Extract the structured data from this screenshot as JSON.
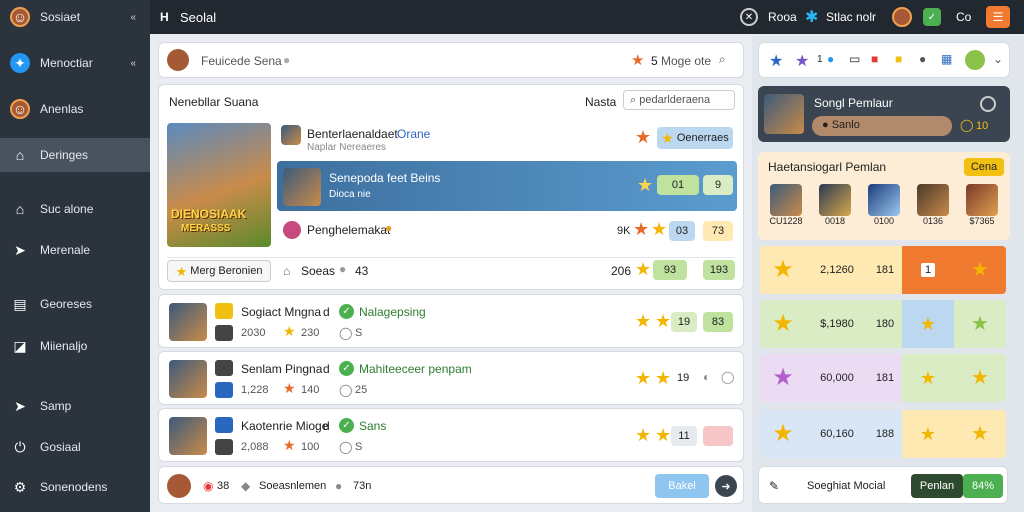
{
  "sidebar": {
    "items": [
      {
        "label": "Sosiaet",
        "icon": "avatar-icon",
        "chev": "«"
      },
      {
        "label": "Menoctiar",
        "icon": "twitter-icon",
        "chev": "«"
      },
      {
        "label": "Anenlas",
        "icon": "avatar-icon"
      },
      {
        "label": "Deringes",
        "icon": "home-icon",
        "active": true
      },
      {
        "label": "Suc alone",
        "icon": "home-icon"
      },
      {
        "label": "Merenale",
        "icon": "send-icon"
      },
      {
        "label": "Georeses",
        "icon": "list-icon"
      },
      {
        "label": "Miienaljo",
        "icon": "chart-icon"
      },
      {
        "label": "Samp",
        "icon": "send-icon"
      },
      {
        "label": "Gosiaal",
        "icon": "power-icon"
      },
      {
        "label": "Sonenodens",
        "icon": "gear-icon"
      }
    ]
  },
  "topbar": {
    "h": "H",
    "title": "Seolal",
    "user": "Rooa",
    "stats": "Stlac nolr",
    "time": "Co"
  },
  "search": {
    "placeholder": "Feuicede Sena",
    "count": "5",
    "hint": "Moge ote"
  },
  "panel": {
    "title": "Nenebllar Suana",
    "tab": "Nasta",
    "search": "pedarlderaena"
  },
  "featured": {
    "title_text": "DIENOSIAAK",
    "sub_text": "MERASSS",
    "items": [
      {
        "title": "Benterlaenaldaet",
        "tag": "Orane",
        "sub": "Naplar Nereaeres",
        "pill": "Oenerraes"
      },
      {
        "title": "Senepoda feet Beins",
        "sub": "Dioca nie",
        "v1": "01",
        "v2": "9"
      },
      {
        "title": "Penghelemakat",
        "l": "9K",
        "v1": "03",
        "v2": "73"
      }
    ],
    "footer": {
      "btn": "Merg Beronien",
      "loc": "Soeas",
      "count": "43",
      "score": "206",
      "v1": "93",
      "v2": "193"
    }
  },
  "rows": [
    {
      "title": "Sogiact Mngna",
      "mark": "d",
      "tag": "Nalagepsing",
      "n1": "2030",
      "n2": "230",
      "n3": "S",
      "v1": "19",
      "v2": "83"
    },
    {
      "title": "Senlam Pingna",
      "mark": "d",
      "tag": "Mahiteeceer penpam",
      "n1": "1,228",
      "n2": "140",
      "n3": "25",
      "v1": "19",
      "v2": ""
    },
    {
      "title": "Kaotenrie Mioge",
      "mark": "d",
      "tag": "Sans",
      "n1": "2,088",
      "n2": "100",
      "n3": "S",
      "v1": "11",
      "v2": ""
    }
  ],
  "bottombar": {
    "count": "38",
    "text": "Soeasnlemen",
    "n": "73n",
    "btn": "Bakel"
  },
  "right": {
    "badge": "1",
    "profile": {
      "name": "Songl Pemlaur",
      "sub": "Sanlo",
      "num": "10"
    },
    "premium": {
      "title": "Haetansiogarl Pemlan",
      "btn": "Cena",
      "avatars": [
        {
          "v": "CU1228"
        },
        {
          "v": "0018"
        },
        {
          "v": "0100"
        },
        {
          "v": "0136"
        },
        {
          "v": "$7365"
        }
      ]
    },
    "rows": [
      {
        "a": "2,1260",
        "b": "181",
        "c": "1",
        "color": "#f07a30"
      },
      {
        "a": "$,1980",
        "b": "180",
        "c": "",
        "color": "#bcd8f0"
      },
      {
        "a": "60,000",
        "b": "181",
        "c": "",
        "color": "#d9ecc3"
      },
      {
        "a": "60,160",
        "b": "188",
        "c": "",
        "color": "#ffe9b3"
      }
    ],
    "footer": {
      "text": "Soeghiat Mocial",
      "btn": "Penlan",
      "pct": "84%"
    }
  }
}
